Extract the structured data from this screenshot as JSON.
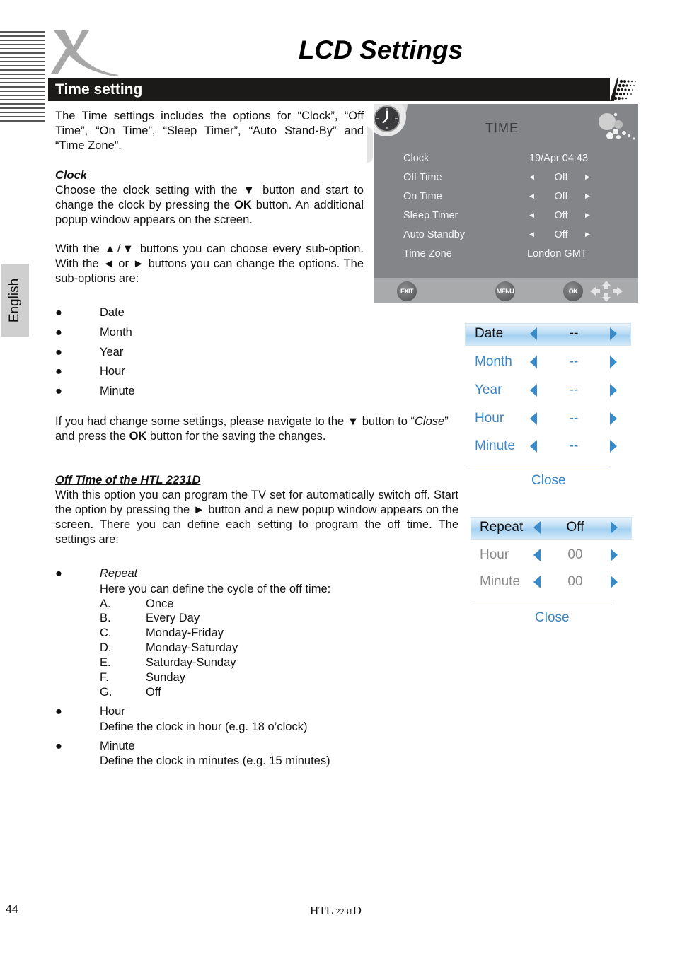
{
  "page": {
    "title": "LCD Settings",
    "section_title": "Time setting",
    "language_tab": "English",
    "page_number": "44",
    "model_prefix": "HTL ",
    "model_number": "2231",
    "model_suffix": "D"
  },
  "intro": "The Time settings includes the options for “Clock”, “Off Time”, “On Time”, “Sleep Timer”, “Auto Stand-By” and “Time Zone”.",
  "clock_section": {
    "heading": "Clock",
    "para1_a": "Choose the clock setting with the ▼ button and start to change the clock by pressing the ",
    "para1_bold": "OK",
    "para1_b": " button. An additional popup window appears on the screen.",
    "para2": "With the ▲/▼ buttons you can choose every sub-option. With the ◄ or ► buttons you can change the options. The sub-options are:",
    "sub_options": [
      "Date",
      "Month",
      "Year",
      "Hour",
      "Minute"
    ],
    "bullet": "●",
    "save_a": "If you had change some settings, please navigate to the ▼ button to “",
    "save_italic": "Close",
    "save_b": "” and press the ",
    "save_bold": "OK",
    "save_c": " button for the saving the changes."
  },
  "off_time_section": {
    "heading": "Off Time of the HTL 2231D",
    "para": "With this option you can program the TV set for automatically switch off. Start the option by pressing the ► button and a new popup window appears on the screen. There you can define each setting to program the off time. The settings are:",
    "items": [
      {
        "label": "Repeat",
        "desc": "Here you can define the cycle of the off time:"
      },
      {
        "label": "Hour",
        "desc": "Define the clock in hour (e.g. 18 o’clock)"
      },
      {
        "label": "Minute",
        "desc": "Define the clock in minutes (e.g. 15 minutes)"
      }
    ],
    "repeat_options": [
      {
        "letter": "A.",
        "text": "Once"
      },
      {
        "letter": "B.",
        "text": "Every Day"
      },
      {
        "letter": "C.",
        "text": "Monday-Friday"
      },
      {
        "letter": "D.",
        "text": "Monday-Saturday"
      },
      {
        "letter": "E.",
        "text": "Saturday-Sunday"
      },
      {
        "letter": "F.",
        "text": "Sunday"
      },
      {
        "letter": "G.",
        "text": "Off"
      }
    ]
  },
  "tv_menu": {
    "title": "TIME",
    "rows": [
      {
        "name": "Clock",
        "value": "19/Apr 04:43"
      },
      {
        "name": "Off Time",
        "value": "Off"
      },
      {
        "name": "On Time",
        "value": "Off"
      },
      {
        "name": "Sleep Timer",
        "value": "Off"
      },
      {
        "name": "Auto Standby",
        "value": "Off"
      },
      {
        "name": "Time Zone",
        "value": "London GMT"
      }
    ],
    "buttons": {
      "exit": "EXIT",
      "menu": "MENU",
      "ok": "OK"
    }
  },
  "clock_popup": {
    "rows": [
      {
        "name": "Date",
        "value": "--"
      },
      {
        "name": "Month",
        "value": "--"
      },
      {
        "name": "Year",
        "value": "--"
      },
      {
        "name": "Hour",
        "value": "--"
      },
      {
        "name": "Minute",
        "value": "--"
      }
    ],
    "close_label": "Close"
  },
  "offtime_popup": {
    "rows": [
      {
        "name": "Repeat",
        "value": "Off"
      },
      {
        "name": "Hour",
        "value": "00"
      },
      {
        "name": "Minute",
        "value": "00"
      }
    ],
    "close_label": "Close"
  },
  "colors": {
    "section_bar": "#1c1a19",
    "tv_background": "#838589",
    "popup_blue": "#3b86c4",
    "popup_highlight": "#b9dbf4"
  }
}
